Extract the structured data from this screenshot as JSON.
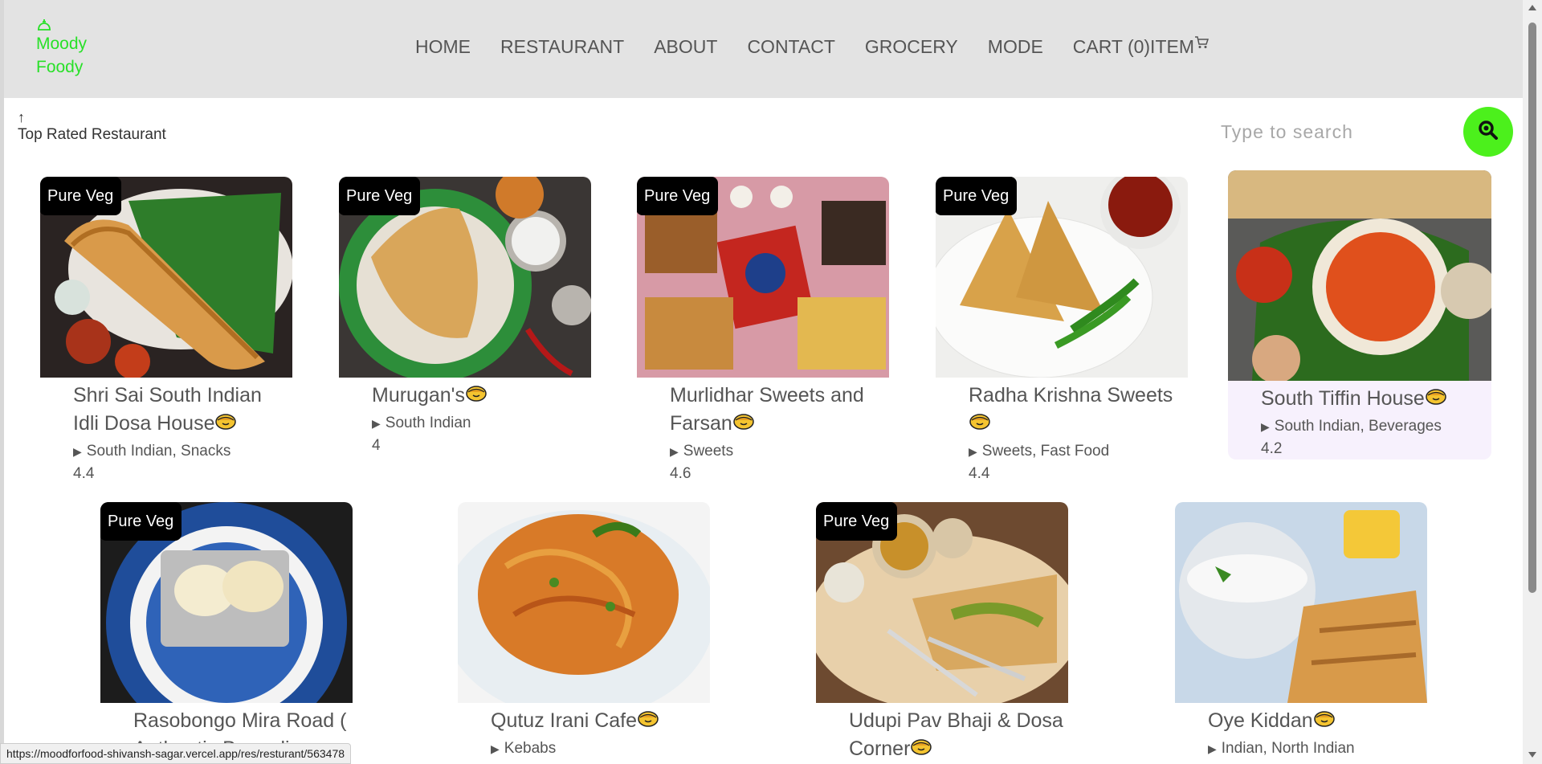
{
  "logo": {
    "icon": "food-tray-icon",
    "line1": "Moody",
    "line2": "Foody"
  },
  "nav": {
    "home": "HOME",
    "restaurant": "RESTAURANT",
    "about": "ABOUT",
    "contact": "CONTACT",
    "grocery": "GROCERY",
    "mode": "MODE",
    "cart": "CART (0)ITEM",
    "cart_icon": "shopping-cart-icon"
  },
  "top_rated": {
    "icon": "arrow-up-icon",
    "label": "Top Rated Restaurant"
  },
  "search": {
    "placeholder": "Type to search",
    "button_icon": "search-icon",
    "button_color": "#4cf01c"
  },
  "badge_label": "Pure Veg",
  "restaurants": [
    {
      "name": "Shri Sai South Indian Idli Dosa House",
      "cuisine": "South Indian, Snacks",
      "rating": "4.4",
      "veg": true,
      "img": "dosa"
    },
    {
      "name": "Murugan's",
      "cuisine": "South Indian",
      "rating": "4",
      "veg": true,
      "img": "dosa-green"
    },
    {
      "name": "Murlidhar Sweets and Farsan",
      "cuisine": "Sweets",
      "rating": "4.6",
      "veg": true,
      "img": "sweets"
    },
    {
      "name": "Radha Krishna Sweets",
      "cuisine": "Sweets, Fast Food",
      "rating": "4.4",
      "veg": true,
      "img": "samosa"
    },
    {
      "name": "South Tiffin House",
      "cuisine": "South Indian, Beverages",
      "rating": "4.2",
      "veg": false,
      "img": "uttapam"
    },
    {
      "name": "Rasobongo Mira Road ( Authentic Bengali...",
      "cuisine": "",
      "rating": "",
      "veg": true,
      "img": "rasgulla"
    },
    {
      "name": "Qutuz Irani Cafe",
      "cuisine": "Kebabs",
      "rating": "",
      "veg": false,
      "img": "noodles"
    },
    {
      "name": "Udupi Pav Bhaji & Dosa Corner",
      "cuisine": "",
      "rating": "",
      "veg": true,
      "img": "masala-dosa"
    },
    {
      "name": "Oye Kiddan",
      "cuisine": "Indian, North Indian",
      "rating": "",
      "veg": false,
      "img": "paratha"
    }
  ],
  "status_url": "https://moodforfood-shivansh-sagar.vercel.app/res/resturant/563478",
  "colors": {
    "header_bg": "#e3e3e3",
    "logo": "#28e028",
    "accent": "#4cf01c",
    "highlight_card": "#f7f1fd"
  }
}
